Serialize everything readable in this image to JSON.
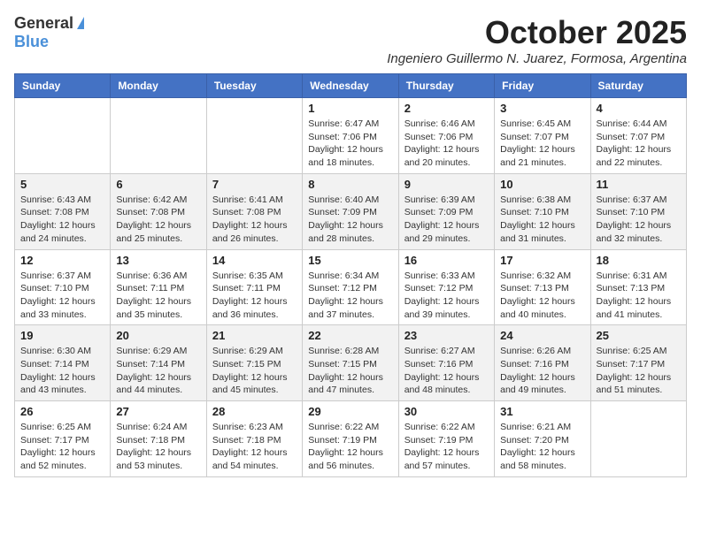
{
  "header": {
    "logo_general": "General",
    "logo_blue": "Blue",
    "month_title": "October 2025",
    "location": "Ingeniero Guillermo N. Juarez, Formosa, Argentina"
  },
  "days_of_week": [
    "Sunday",
    "Monday",
    "Tuesday",
    "Wednesday",
    "Thursday",
    "Friday",
    "Saturday"
  ],
  "weeks": [
    [
      {
        "day": "",
        "info": ""
      },
      {
        "day": "",
        "info": ""
      },
      {
        "day": "",
        "info": ""
      },
      {
        "day": "1",
        "info": "Sunrise: 6:47 AM\nSunset: 7:06 PM\nDaylight: 12 hours and 18 minutes."
      },
      {
        "day": "2",
        "info": "Sunrise: 6:46 AM\nSunset: 7:06 PM\nDaylight: 12 hours and 20 minutes."
      },
      {
        "day": "3",
        "info": "Sunrise: 6:45 AM\nSunset: 7:07 PM\nDaylight: 12 hours and 21 minutes."
      },
      {
        "day": "4",
        "info": "Sunrise: 6:44 AM\nSunset: 7:07 PM\nDaylight: 12 hours and 22 minutes."
      }
    ],
    [
      {
        "day": "5",
        "info": "Sunrise: 6:43 AM\nSunset: 7:08 PM\nDaylight: 12 hours and 24 minutes."
      },
      {
        "day": "6",
        "info": "Sunrise: 6:42 AM\nSunset: 7:08 PM\nDaylight: 12 hours and 25 minutes."
      },
      {
        "day": "7",
        "info": "Sunrise: 6:41 AM\nSunset: 7:08 PM\nDaylight: 12 hours and 26 minutes."
      },
      {
        "day": "8",
        "info": "Sunrise: 6:40 AM\nSunset: 7:09 PM\nDaylight: 12 hours and 28 minutes."
      },
      {
        "day": "9",
        "info": "Sunrise: 6:39 AM\nSunset: 7:09 PM\nDaylight: 12 hours and 29 minutes."
      },
      {
        "day": "10",
        "info": "Sunrise: 6:38 AM\nSunset: 7:10 PM\nDaylight: 12 hours and 31 minutes."
      },
      {
        "day": "11",
        "info": "Sunrise: 6:37 AM\nSunset: 7:10 PM\nDaylight: 12 hours and 32 minutes."
      }
    ],
    [
      {
        "day": "12",
        "info": "Sunrise: 6:37 AM\nSunset: 7:10 PM\nDaylight: 12 hours and 33 minutes."
      },
      {
        "day": "13",
        "info": "Sunrise: 6:36 AM\nSunset: 7:11 PM\nDaylight: 12 hours and 35 minutes."
      },
      {
        "day": "14",
        "info": "Sunrise: 6:35 AM\nSunset: 7:11 PM\nDaylight: 12 hours and 36 minutes."
      },
      {
        "day": "15",
        "info": "Sunrise: 6:34 AM\nSunset: 7:12 PM\nDaylight: 12 hours and 37 minutes."
      },
      {
        "day": "16",
        "info": "Sunrise: 6:33 AM\nSunset: 7:12 PM\nDaylight: 12 hours and 39 minutes."
      },
      {
        "day": "17",
        "info": "Sunrise: 6:32 AM\nSunset: 7:13 PM\nDaylight: 12 hours and 40 minutes."
      },
      {
        "day": "18",
        "info": "Sunrise: 6:31 AM\nSunset: 7:13 PM\nDaylight: 12 hours and 41 minutes."
      }
    ],
    [
      {
        "day": "19",
        "info": "Sunrise: 6:30 AM\nSunset: 7:14 PM\nDaylight: 12 hours and 43 minutes."
      },
      {
        "day": "20",
        "info": "Sunrise: 6:29 AM\nSunset: 7:14 PM\nDaylight: 12 hours and 44 minutes."
      },
      {
        "day": "21",
        "info": "Sunrise: 6:29 AM\nSunset: 7:15 PM\nDaylight: 12 hours and 45 minutes."
      },
      {
        "day": "22",
        "info": "Sunrise: 6:28 AM\nSunset: 7:15 PM\nDaylight: 12 hours and 47 minutes."
      },
      {
        "day": "23",
        "info": "Sunrise: 6:27 AM\nSunset: 7:16 PM\nDaylight: 12 hours and 48 minutes."
      },
      {
        "day": "24",
        "info": "Sunrise: 6:26 AM\nSunset: 7:16 PM\nDaylight: 12 hours and 49 minutes."
      },
      {
        "day": "25",
        "info": "Sunrise: 6:25 AM\nSunset: 7:17 PM\nDaylight: 12 hours and 51 minutes."
      }
    ],
    [
      {
        "day": "26",
        "info": "Sunrise: 6:25 AM\nSunset: 7:17 PM\nDaylight: 12 hours and 52 minutes."
      },
      {
        "day": "27",
        "info": "Sunrise: 6:24 AM\nSunset: 7:18 PM\nDaylight: 12 hours and 53 minutes."
      },
      {
        "day": "28",
        "info": "Sunrise: 6:23 AM\nSunset: 7:18 PM\nDaylight: 12 hours and 54 minutes."
      },
      {
        "day": "29",
        "info": "Sunrise: 6:22 AM\nSunset: 7:19 PM\nDaylight: 12 hours and 56 minutes."
      },
      {
        "day": "30",
        "info": "Sunrise: 6:22 AM\nSunset: 7:19 PM\nDaylight: 12 hours and 57 minutes."
      },
      {
        "day": "31",
        "info": "Sunrise: 6:21 AM\nSunset: 7:20 PM\nDaylight: 12 hours and 58 minutes."
      },
      {
        "day": "",
        "info": ""
      }
    ]
  ]
}
